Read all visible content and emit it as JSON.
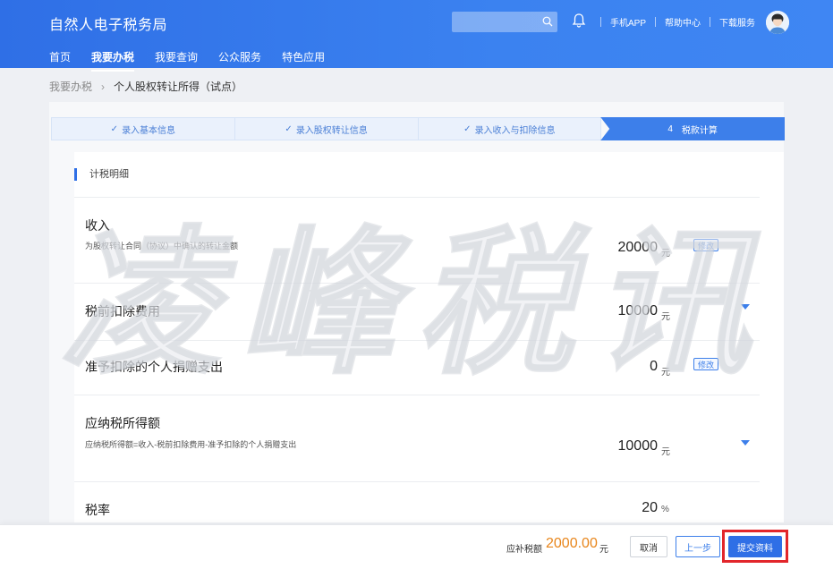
{
  "header": {
    "brand": "自然人电子税务局",
    "search_placeholder": "",
    "links": [
      "手机APP",
      "帮助中心",
      "下载服务"
    ],
    "nav": [
      "首页",
      "我要办税",
      "我要查询",
      "公众服务",
      "特色应用"
    ],
    "active_nav": 1
  },
  "breadcrumb": {
    "parent": "我要办税",
    "current": "个人股权转让所得（试点）"
  },
  "steps": [
    {
      "label": "录入基本信息",
      "done": true
    },
    {
      "label": "录入股权转让信息",
      "done": true
    },
    {
      "label": "录入收入与扣除信息",
      "done": true
    },
    {
      "number": "4",
      "label": "税款计算",
      "active": true
    }
  ],
  "section": {
    "title": "计税明细"
  },
  "rows": {
    "income": {
      "label": "收入",
      "desc": "为股权转让合同（协议）中确认的转让金额",
      "value": "20000",
      "unit": "元",
      "action": "修改"
    },
    "pretax_deduction": {
      "label": "税前扣除费用",
      "value": "10000",
      "unit": "元"
    },
    "donation": {
      "label": "准予扣除的个人捐赠支出",
      "value": "0",
      "unit": "元",
      "action": "修改"
    },
    "taxable_income": {
      "label": "应纳税所得额",
      "desc": "应纳税所得额=收入-税前扣除费用-准予扣除的个人捐赠支出",
      "value": "10000",
      "unit": "元"
    },
    "tax_rate": {
      "label": "税率",
      "value": "20",
      "unit": "%"
    }
  },
  "watermark": "凌峰税讯",
  "footer": {
    "tax_label": "应补税额",
    "tax_amount": "2000.00",
    "tax_unit": "元",
    "cancel": "取消",
    "prev": "上一步",
    "submit": "提交资料"
  },
  "colors": {
    "header_blue": "#2f6fe6",
    "accent_blue": "#3d7fea",
    "amount_orange": "#e8851a",
    "highlight_red": "#e2262b"
  }
}
